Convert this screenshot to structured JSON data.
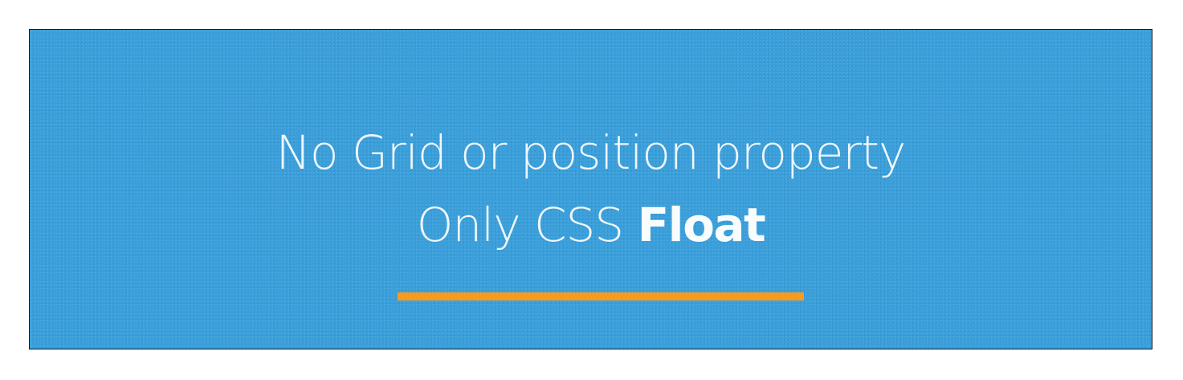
{
  "headline": {
    "line1": "No Grid or position property",
    "line2_prefix": "Only CSS",
    "line2_emphasis": "Float"
  },
  "colors": {
    "background": "#3a9fda",
    "text": "#ffffff",
    "accent": "#f79a1e",
    "border": "#1b1b1b"
  }
}
